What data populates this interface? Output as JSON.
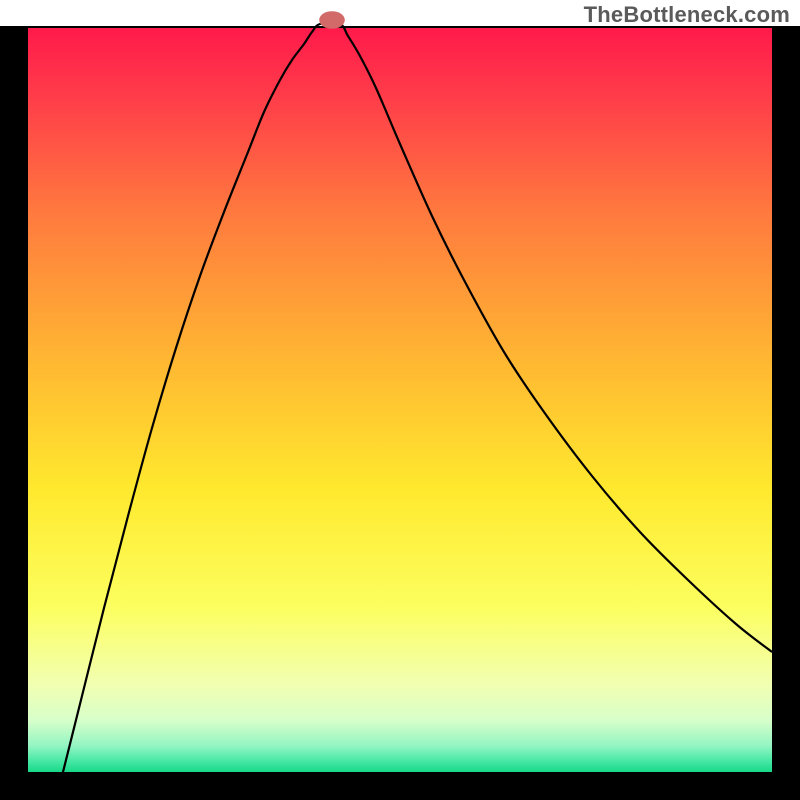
{
  "watermark": "TheBottleneck.com",
  "chart_data": {
    "type": "line",
    "title": "",
    "xlabel": "",
    "ylabel": "",
    "xlim": [
      0,
      100
    ],
    "ylim": [
      0,
      100
    ],
    "background_gradient": {
      "stops": [
        {
          "offset": 0.0,
          "color": "#ff1a4b"
        },
        {
          "offset": 0.1,
          "color": "#ff3f49"
        },
        {
          "offset": 0.25,
          "color": "#ff7a3e"
        },
        {
          "offset": 0.45,
          "color": "#ffb832"
        },
        {
          "offset": 0.62,
          "color": "#ffe92e"
        },
        {
          "offset": 0.78,
          "color": "#fcff60"
        },
        {
          "offset": 0.88,
          "color": "#f2ffb0"
        },
        {
          "offset": 0.93,
          "color": "#d8ffca"
        },
        {
          "offset": 0.965,
          "color": "#93f5c3"
        },
        {
          "offset": 0.985,
          "color": "#47e8a5"
        },
        {
          "offset": 1.0,
          "color": "#18d889"
        }
      ]
    },
    "frame": {
      "x": 3.5,
      "y": 3.5,
      "width": 93,
      "height": 93,
      "color": "#000000"
    },
    "marker": {
      "x": 41.5,
      "y": 97.5,
      "rx": 1.6,
      "ry": 1.1,
      "color": "#d26a6a"
    },
    "series": [
      {
        "name": "bottleneck-curve",
        "color": "#000000",
        "x": [
          7.0,
          10.0,
          13.0,
          16.0,
          19.0,
          22.0,
          25.0,
          28.0,
          31.0,
          33.0,
          35.0,
          36.5,
          38.0,
          39.0,
          40.0,
          42.5,
          43.5,
          45.0,
          47.0,
          50.0,
          54.0,
          58.0,
          63.0,
          68.0,
          74.0,
          80.0,
          86.0,
          92.0,
          96.5
        ],
        "y": [
          0.0,
          12.0,
          24.0,
          35.5,
          46.5,
          56.5,
          65.5,
          73.5,
          81.0,
          86.0,
          90.0,
          92.5,
          94.5,
          96.0,
          97.0,
          97.0,
          95.5,
          93.0,
          89.0,
          82.0,
          73.0,
          65.0,
          56.0,
          48.5,
          40.5,
          33.5,
          27.5,
          22.0,
          18.5
        ]
      }
    ]
  }
}
